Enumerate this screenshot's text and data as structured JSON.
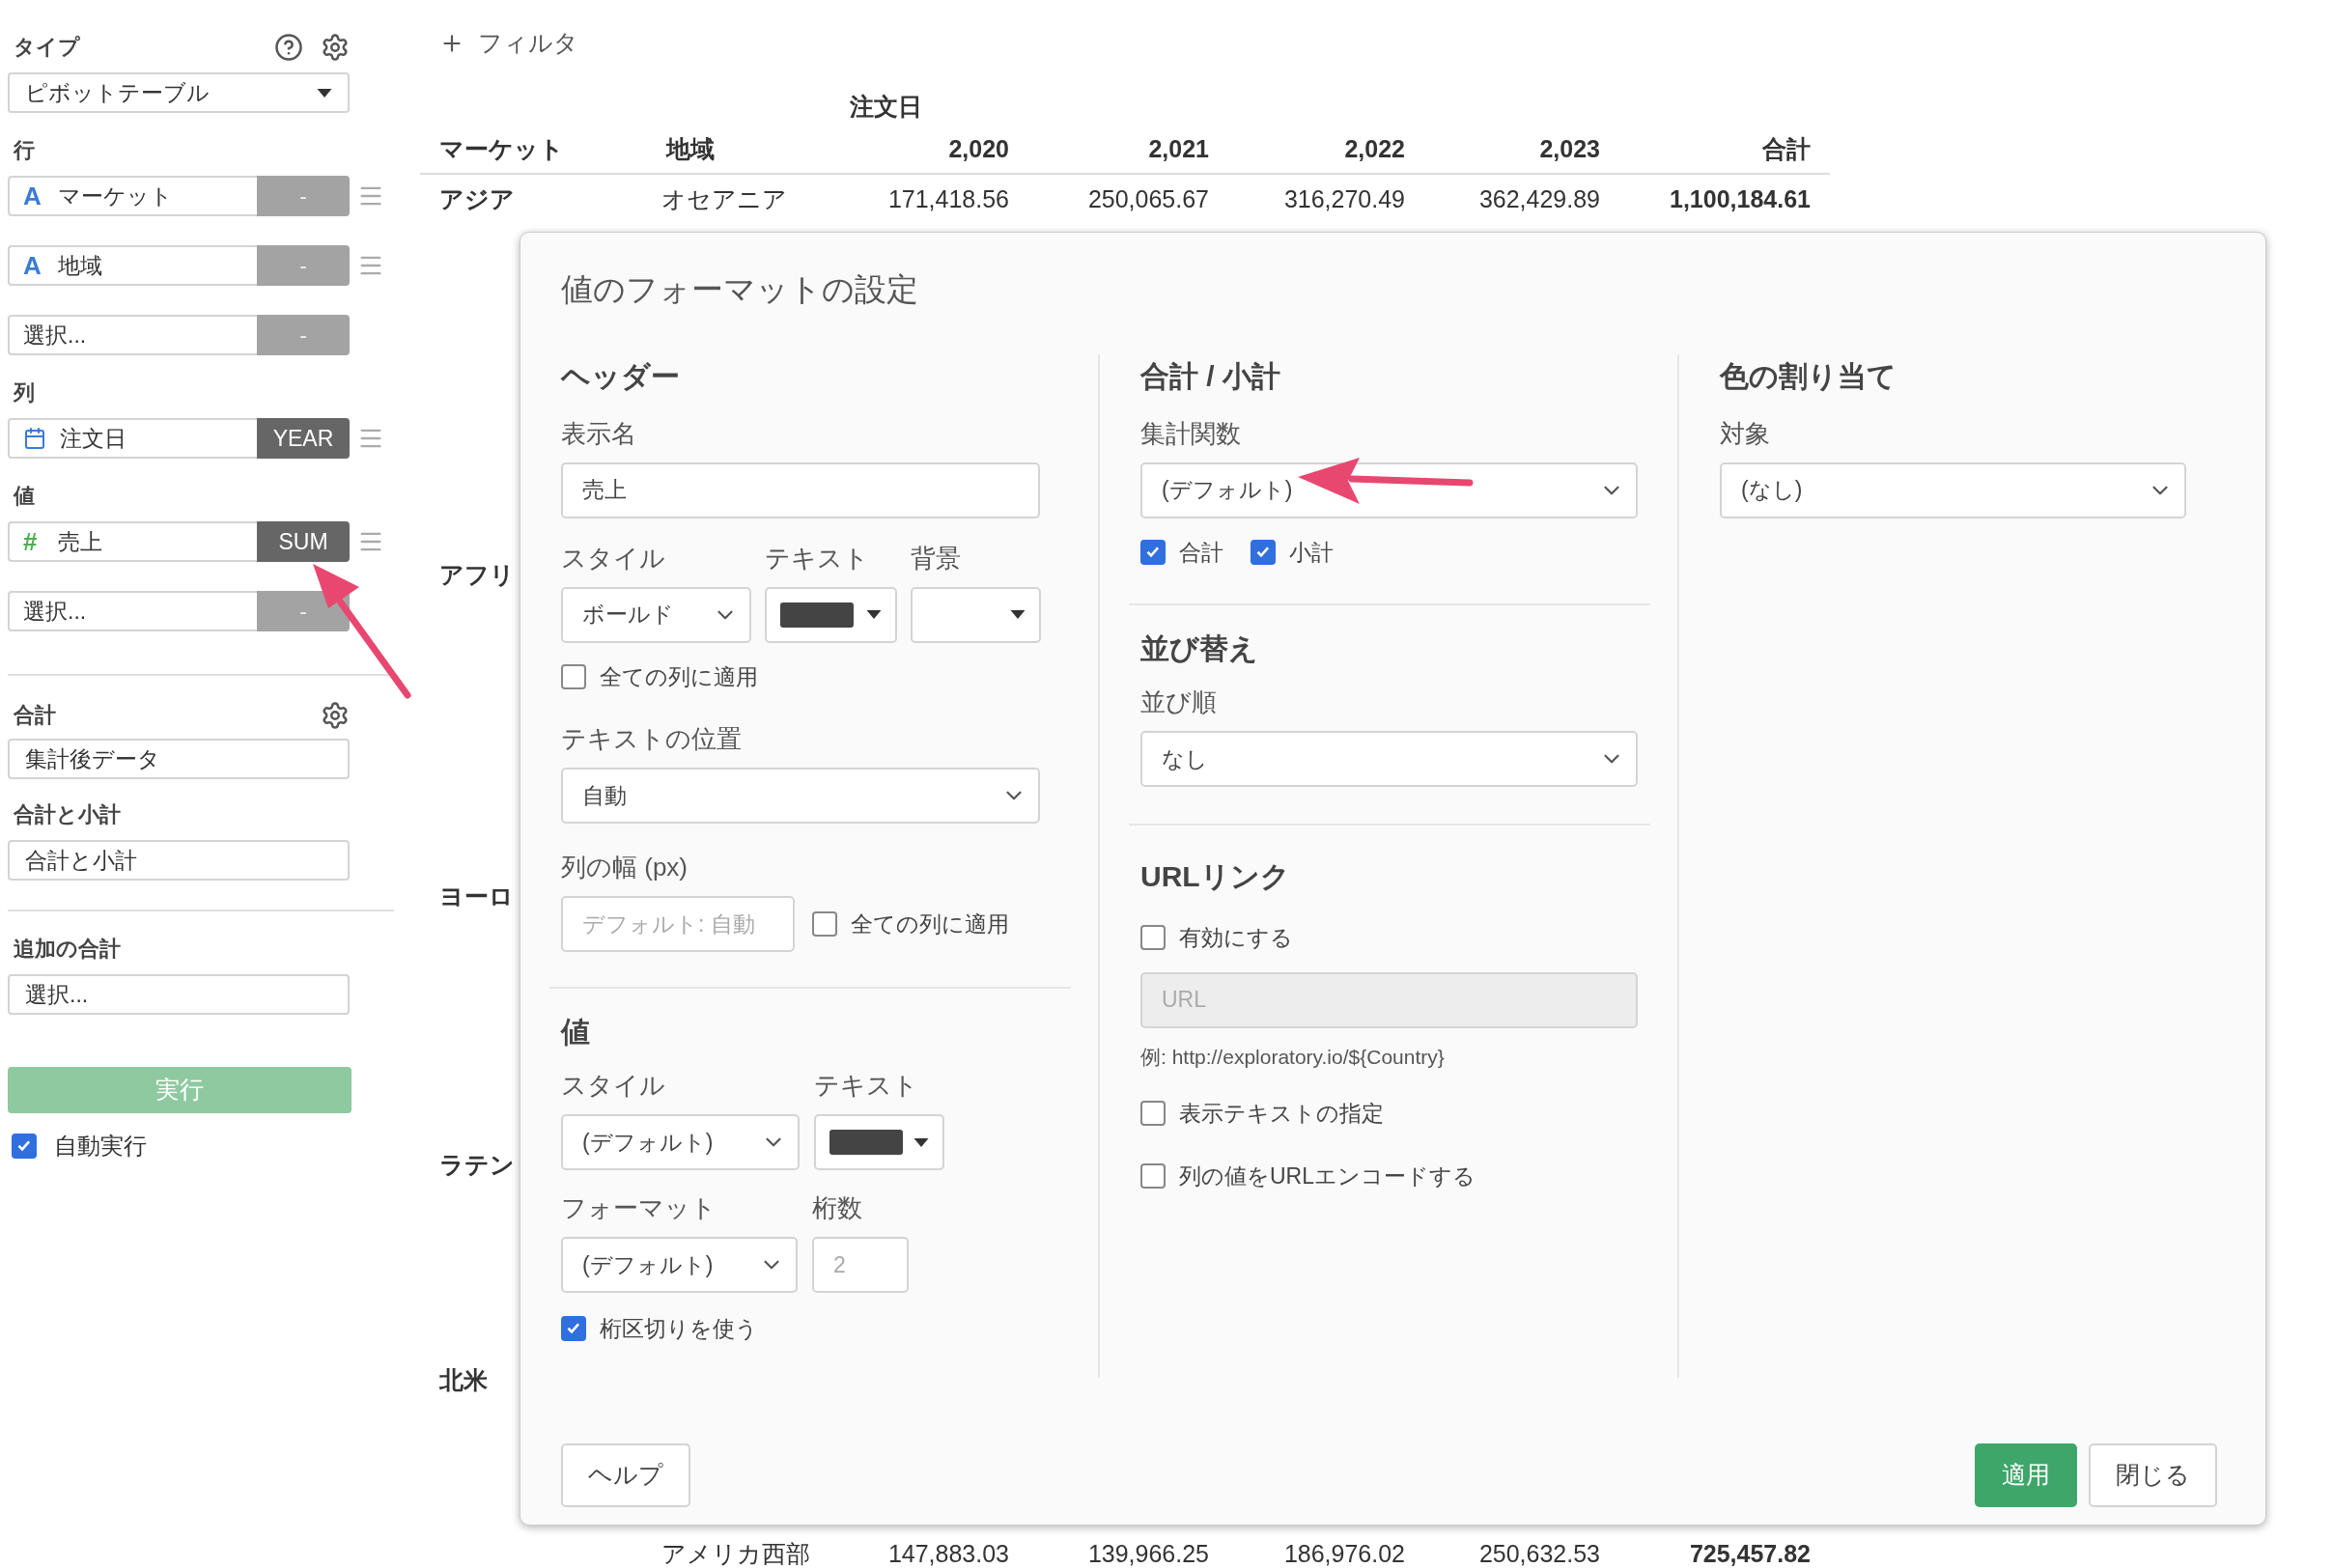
{
  "sidebar": {
    "type": {
      "label": "タイプ",
      "value": "ピボットテーブル"
    },
    "groups": [
      {
        "label": "行",
        "fields": [
          {
            "kind": "text",
            "icon": "A",
            "name": "マーケット",
            "func": "-",
            "func_set": false
          },
          {
            "kind": "text",
            "icon": "A",
            "name": "地域",
            "func": "-",
            "func_set": false
          },
          {
            "kind": "empty",
            "name": "選択...",
            "func": "-",
            "func_set": false
          }
        ]
      },
      {
        "label": "列",
        "fields": [
          {
            "kind": "date",
            "name": "注文日",
            "func": "YEAR",
            "func_set": true
          }
        ]
      },
      {
        "label": "値",
        "fields": [
          {
            "kind": "number",
            "icon": "#",
            "name": "売上",
            "func": "SUM",
            "func_set": true
          },
          {
            "kind": "empty",
            "name": "選択...",
            "func": "-",
            "func_set": false
          }
        ]
      }
    ],
    "total": {
      "label": "合計",
      "value": "集計後データ"
    },
    "subtotal": {
      "label": "合計と小計",
      "value": "合計と小計"
    },
    "extra_total": {
      "label": "追加の合計",
      "value": "選択..."
    },
    "run_button": "実行",
    "auto_run": {
      "label": "自動実行",
      "checked": true
    }
  },
  "filter_button": "フィルタ",
  "table": {
    "column_group": "注文日",
    "columns": [
      "マーケット",
      "地域",
      "2,020",
      "2,021",
      "2,022",
      "2,023",
      "合計"
    ],
    "rows": [
      {
        "market": "アジア",
        "region": "オセアニア",
        "values": [
          "171,418.56",
          "250,065.67",
          "316,270.49",
          "362,429.89"
        ],
        "total": "1,100,184.61"
      },
      {
        "market": "アフリ"
      },
      {
        "market": "ヨーロ"
      },
      {
        "market": "ラテン"
      },
      {
        "market": "北米"
      },
      {
        "region": "アメリカ西部",
        "values": [
          "147,883.03",
          "139,966.25",
          "186,976.02",
          "250,632.53"
        ],
        "total": "725,457.82"
      }
    ]
  },
  "dialog": {
    "title": "値のフォーマットの設定",
    "header": {
      "heading": "ヘッダー",
      "display_name": {
        "label": "表示名",
        "value": "売上"
      },
      "style": {
        "label": "スタイル",
        "value": "ボールド"
      },
      "text_color": {
        "label": "テキスト",
        "color": "#444444"
      },
      "background": {
        "label": "背景"
      },
      "apply_all": {
        "label": "全ての列に適用",
        "checked": false
      },
      "text_position": {
        "label": "テキストの位置",
        "value": "自動"
      },
      "column_width": {
        "label": "列の幅 (px)",
        "placeholder": "デフォルト: 自動"
      },
      "width_apply_all": {
        "label": "全ての列に適用",
        "checked": false
      }
    },
    "value": {
      "heading": "値",
      "style": {
        "label": "スタイル",
        "value": "(デフォルト)"
      },
      "text_color": {
        "label": "テキスト",
        "color": "#444444"
      },
      "format": {
        "label": "フォーマット",
        "value": "(デフォルト)"
      },
      "digits": {
        "label": "桁数",
        "placeholder": "2"
      },
      "separator": {
        "label": "桁区切りを使う",
        "checked": true
      }
    },
    "totals": {
      "heading": "合計 / 小計",
      "aggregate": {
        "label": "集計関数",
        "value": "(デフォルト)"
      },
      "checks": [
        {
          "label": "合計",
          "checked": true
        },
        {
          "label": "小計",
          "checked": true
        }
      ]
    },
    "sort": {
      "heading": "並び替え",
      "order": {
        "label": "並び順",
        "value": "なし"
      }
    },
    "url_link": {
      "heading": "URLリンク",
      "enable": {
        "label": "有効にする",
        "checked": false
      },
      "url": {
        "placeholder": "URL",
        "disabled": true
      },
      "example": "例: http://exploratory.io/${Country}",
      "display_text": {
        "label": "表示テキストの指定",
        "checked": false
      },
      "encode": {
        "label": "列の値をURLエンコードする",
        "checked": false
      }
    },
    "color_assign": {
      "heading": "色の割り当て",
      "target": {
        "label": "対象",
        "value": "(なし)"
      }
    },
    "help_button": "ヘルプ",
    "buttons": [
      {
        "label": "適用",
        "kind": "primary"
      },
      {
        "label": "閉じる",
        "kind": "secondary"
      }
    ]
  }
}
